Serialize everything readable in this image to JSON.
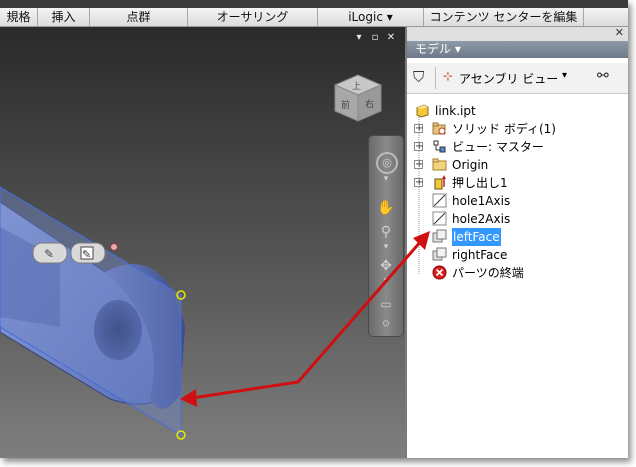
{
  "ribbon": {
    "tabs": [
      "規格",
      "挿入",
      "点群",
      "オーサリング",
      "iLogic ▾",
      "コンテンツ センターを編集"
    ]
  },
  "window_controls": {
    "pin": "▾",
    "restore": "▫",
    "close": "✕"
  },
  "viewcube": {
    "top": "上",
    "front": "前",
    "right": "右"
  },
  "navbar": {
    "icons": [
      "steering-wheel",
      "pan",
      "zoom",
      "orbit",
      "look-at"
    ]
  },
  "model_panel": {
    "title": "モデル ▾",
    "toolbar": {
      "filter_icon": "filter-icon",
      "view_label": "アセンブリ ビュー",
      "view_dropdown": "▾",
      "find_icon": "binoculars-icon"
    },
    "tree": [
      {
        "label": "link.ipt",
        "icon": "part-icon",
        "expander": ""
      },
      {
        "label": "ソリッド ボディ(1)",
        "icon": "solid-bodies-folder-icon",
        "expander": "+"
      },
      {
        "label": "ビュー: マスター",
        "icon": "view-rep-icon",
        "expander": "+"
      },
      {
        "label": "Origin",
        "icon": "folder-icon",
        "expander": "+"
      },
      {
        "label": "押し出し1",
        "icon": "extrude-icon",
        "expander": "+"
      },
      {
        "label": "hole1Axis",
        "icon": "work-axis-icon",
        "expander": ""
      },
      {
        "label": "hole2Axis",
        "icon": "work-axis-icon",
        "expander": ""
      },
      {
        "label": "leftFace",
        "icon": "work-plane-icon",
        "expander": "",
        "selected": true
      },
      {
        "label": "rightFace",
        "icon": "work-plane-icon",
        "expander": ""
      },
      {
        "label": "パーツの終端",
        "icon": "end-of-part-icon",
        "expander": ""
      }
    ]
  },
  "colors": {
    "selection": "#3399ff",
    "plane": "#6f86c9",
    "arrow": "#d01010",
    "panel_title": "#7a8594"
  }
}
